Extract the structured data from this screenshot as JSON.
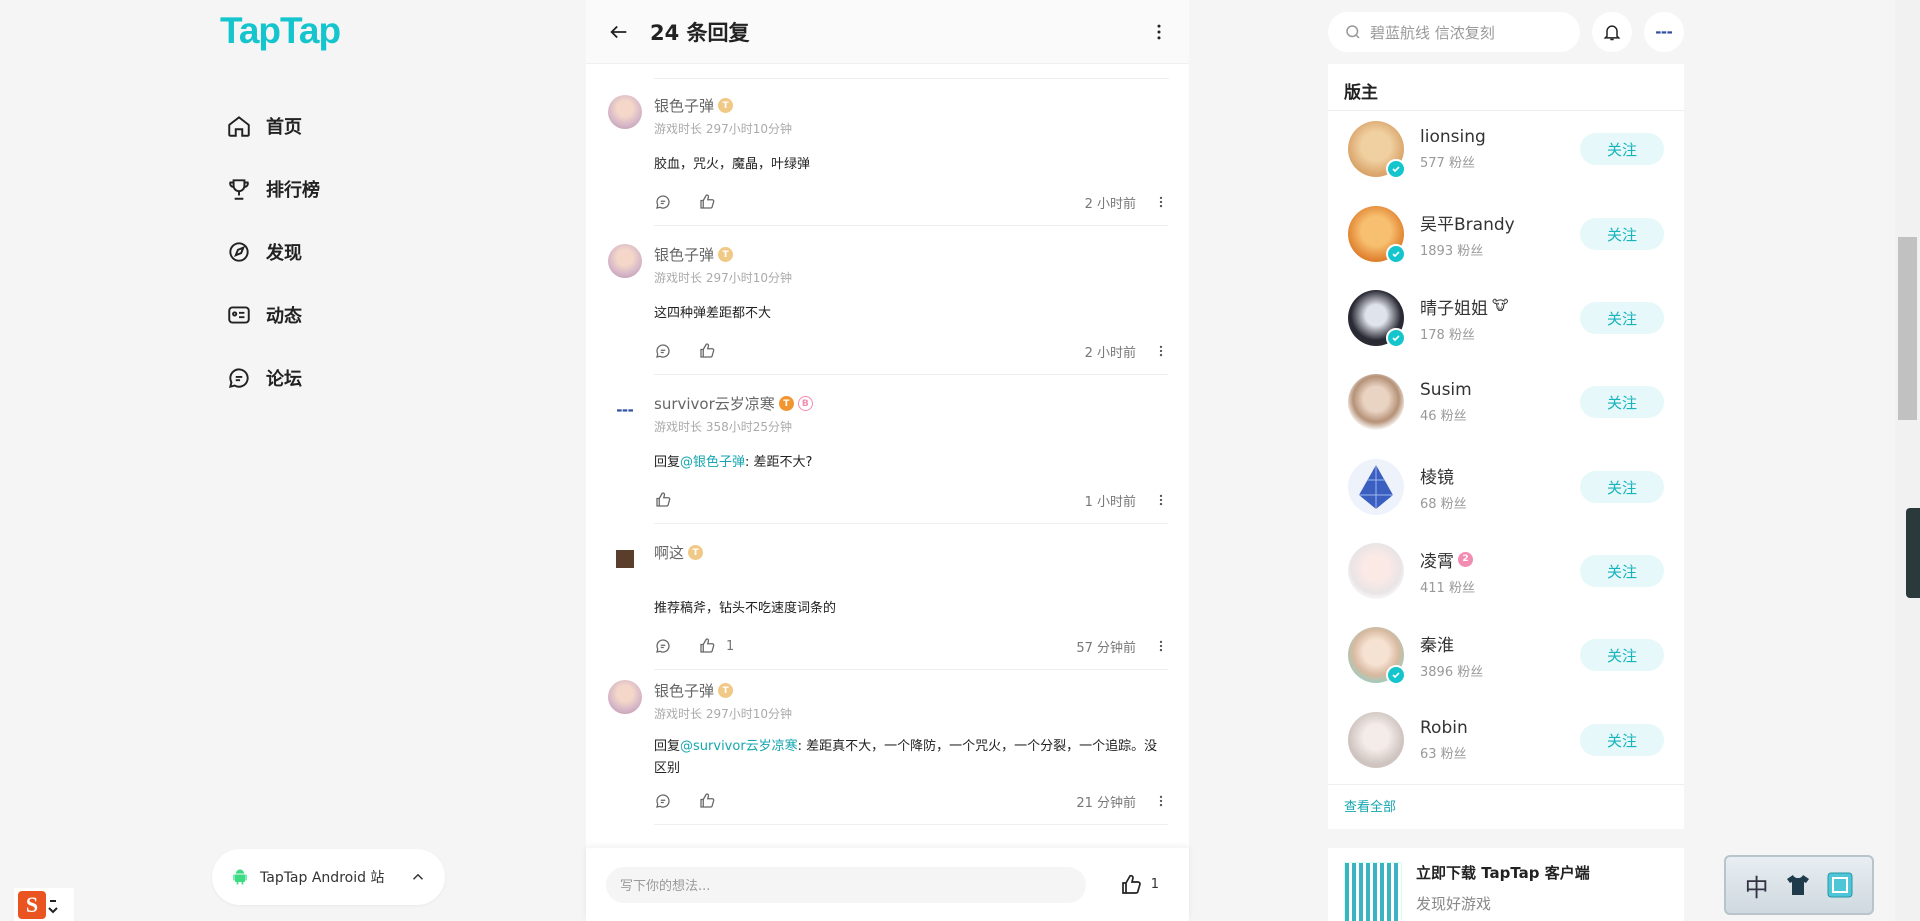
{
  "logo": "TapTap",
  "nav": [
    {
      "label": "首页",
      "icon": "home-icon"
    },
    {
      "label": "排行榜",
      "icon": "trophy-icon"
    },
    {
      "label": "发现",
      "icon": "discover-icon"
    },
    {
      "label": "动态",
      "icon": "moments-icon"
    },
    {
      "label": "论坛",
      "icon": "forum-icon"
    }
  ],
  "android_pill": {
    "label": "TapTap Android 站"
  },
  "header": {
    "title": "24 条回复"
  },
  "replies": [
    {
      "name": "银色子弹",
      "playtime": "游戏时长 297小时10分钟",
      "text": "胶血，咒火，魔晶，叶绿弹",
      "time": "2 小时前",
      "likes": ""
    },
    {
      "name": "银色子弹",
      "playtime": "游戏时长 297小时10分钟",
      "text": "这四种弹差距都不大",
      "time": "2 小时前",
      "likes": ""
    },
    {
      "name": "survivor云岁凉寒",
      "playtime": "游戏时长 358小时25分钟",
      "reply_prefix": "回复",
      "mention": "@银色子弹",
      "text": ": 差距不大?",
      "time": "1 小时前",
      "likes": ""
    },
    {
      "name": "啊这",
      "playtime": "",
      "text": "推荐稿斧，钻头不吃速度词条的",
      "time": "57 分钟前",
      "likes": "1"
    },
    {
      "name": "银色子弹",
      "playtime": "游戏时长 297小时10分钟",
      "reply_prefix": "回复",
      "mention": "@survivor云岁凉寒",
      "text": ": 差距真不大，一个降防，一个咒火，一个分裂，一个追踪。没区别",
      "time": "21 分钟前",
      "likes": ""
    }
  ],
  "composer": {
    "placeholder": "写下你的想法...",
    "likes": "1"
  },
  "search": {
    "placeholder": "碧蓝航线 信浓复刻"
  },
  "moderators": {
    "title": "版主",
    "follow_label": "关注",
    "view_all": "查看全部",
    "list": [
      {
        "name": "lionsing",
        "fans": "577 粉丝",
        "verified": true,
        "color": "#d9a36a"
      },
      {
        "name": "吴平Brandy",
        "fans": "1893 粉丝",
        "verified": true,
        "color": "#e0812f"
      },
      {
        "name": "晴子姐姐",
        "fans": "178 粉丝",
        "verified": true,
        "color": "#2a2a35"
      },
      {
        "name": "Susim",
        "fans": "46 粉丝",
        "verified": false,
        "color": "#b59177"
      },
      {
        "name": "棱镜",
        "fans": "68 粉丝",
        "verified": false,
        "color": "#3a5fc0"
      },
      {
        "name": "凌霄",
        "fans": "411 粉丝",
        "verified": false,
        "color": "#e9e4e6"
      },
      {
        "name": "秦淮",
        "fans": "3896 粉丝",
        "verified": true,
        "color": "#d8b9a0"
      },
      {
        "name": "Robin",
        "fans": "63 粉丝",
        "verified": false,
        "color": "#cfc4c0"
      }
    ]
  },
  "download": {
    "title": "立即下载 TapTap 客户端",
    "subtitle": "发现好游戏"
  },
  "ime": {
    "label": "中"
  },
  "colors": {
    "brand": "#15c5ce",
    "mention": "#15a6b0"
  }
}
